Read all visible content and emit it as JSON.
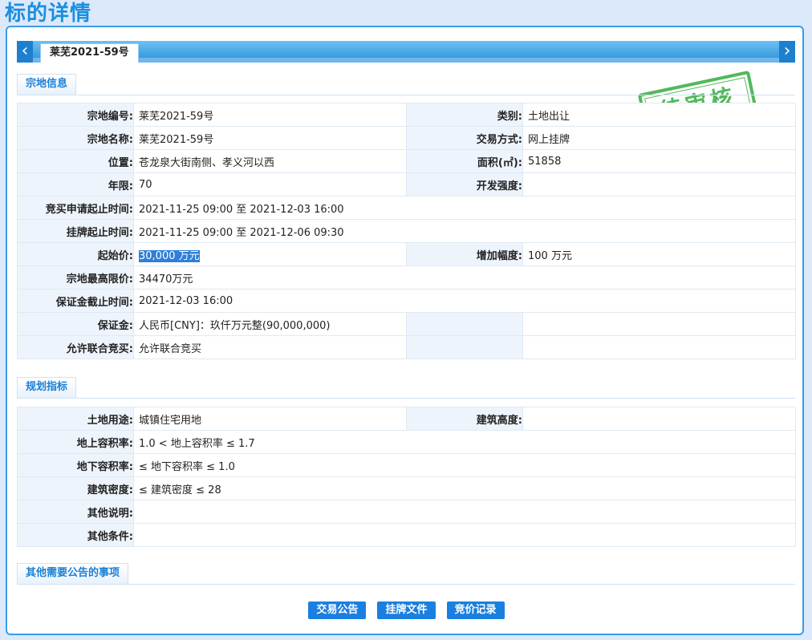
{
  "page_title": "标的详情",
  "tab": {
    "label": "莱芜2021-59号"
  },
  "stamp": {
    "text": "待审核",
    "color": "#3fb24a"
  },
  "sections": {
    "land": {
      "title": "宗地信息",
      "rows": [
        {
          "l1": "宗地编号:",
          "v1": "莱芜2021-59号",
          "l2": "类别:",
          "v2": "土地出让"
        },
        {
          "l1": "宗地名称:",
          "v1": "莱芜2021-59号",
          "l2": "交易方式:",
          "v2": "网上挂牌"
        },
        {
          "l1": "位置:",
          "v1": "苍龙泉大街南侧、孝义河以西",
          "l2": "面积(㎡):",
          "v2": "51858"
        },
        {
          "l1": "年限:",
          "v1": "70",
          "l2": "开发强度:",
          "v2": ""
        },
        {
          "l1": "竞买申请起止时间:",
          "v1": "2021-11-25 09:00 至 2021-12-03 16:00"
        },
        {
          "l1": "挂牌起止时间:",
          "v1": "2021-11-25 09:00 至 2021-12-06 09:30"
        },
        {
          "l1": "起始价:",
          "v1": "30,000 万元",
          "l2": "增加幅度:",
          "v2": "100 万元"
        },
        {
          "l1": "宗地最高限价:",
          "v1": "34470万元"
        },
        {
          "l1": "保证金截止时间:",
          "v1": "2021-12-03 16:00"
        },
        {
          "l1": "保证金:",
          "v1": "人民币[CNY]：玖仟万元整(90,000,000)",
          "l2": "",
          "v2": ""
        },
        {
          "l1": "允许联合竞买:",
          "v1": "允许联合竞买",
          "l2": "",
          "v2": ""
        }
      ]
    },
    "planning": {
      "title": "规划指标",
      "rows": [
        {
          "l1": "土地用途:",
          "v1": "城镇住宅用地",
          "l2": "建筑高度:",
          "v2": ""
        },
        {
          "l1": "地上容积率:",
          "v1": "1.0 < 地上容积率 ≤ 1.7"
        },
        {
          "l1": "地下容积率:",
          "v1": "≤ 地下容积率 ≤ 1.0"
        },
        {
          "l1": "建筑密度:",
          "v1": "≤ 建筑密度 ≤ 28"
        },
        {
          "l1": "其他说明:",
          "v1": ""
        },
        {
          "l1": "其他条件:",
          "v1": ""
        }
      ]
    },
    "other": {
      "title": "其他需要公告的事项"
    }
  },
  "buttons": [
    "交易公告",
    "挂牌文件",
    "竞价记录"
  ]
}
